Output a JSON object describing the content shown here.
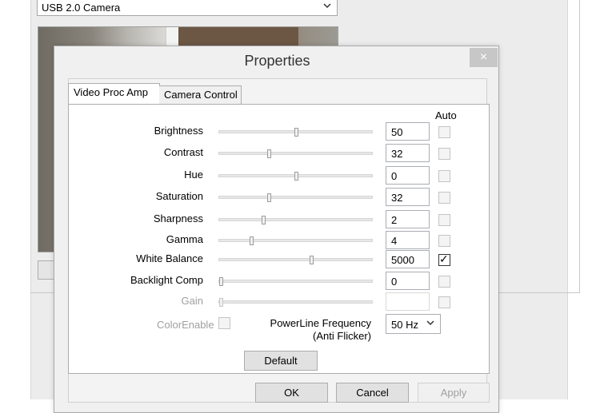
{
  "background_window": {
    "device_select_value": "USB 2.0 Camera"
  },
  "dialog": {
    "title": "Properties",
    "close_glyph": "×",
    "tabs": [
      {
        "label": "Video Proc Amp",
        "active": true
      },
      {
        "label": "Camera Control",
        "active": false
      }
    ],
    "auto_header": "Auto",
    "rows": [
      {
        "label": "Brightness",
        "value": "50",
        "slider": 0.5,
        "auto": false,
        "enabled": true
      },
      {
        "label": "Contrast",
        "value": "32",
        "slider": 0.32,
        "auto": false,
        "enabled": true
      },
      {
        "label": "Hue",
        "value": "0",
        "slider": 0.5,
        "auto": false,
        "enabled": true
      },
      {
        "label": "Saturation",
        "value": "32",
        "slider": 0.32,
        "auto": false,
        "enabled": true
      },
      {
        "label": "Sharpness",
        "value": "2",
        "slider": 0.28,
        "auto": false,
        "enabled": true
      },
      {
        "label": "Gamma",
        "value": "4",
        "slider": 0.2,
        "auto": false,
        "enabled": true
      },
      {
        "label": "White Balance",
        "value": "5000",
        "slider": 0.6,
        "auto": true,
        "enabled": true
      },
      {
        "label": "Backlight Comp",
        "value": "0",
        "slider": 0.0,
        "auto": false,
        "enabled": true
      },
      {
        "label": "Gain",
        "value": "",
        "slider": 0.0,
        "auto": false,
        "enabled": false
      }
    ],
    "color_enable_label": "ColorEnable",
    "powerline_label_line1": "PowerLine Frequency",
    "powerline_label_line2": "(Anti Flicker)",
    "powerline_value": "50 Hz",
    "default_label": "Default",
    "ok_label": "OK",
    "cancel_label": "Cancel",
    "apply_label": "Apply",
    "checkmark_glyph": "✓",
    "chevron_glyph": "⌄"
  }
}
